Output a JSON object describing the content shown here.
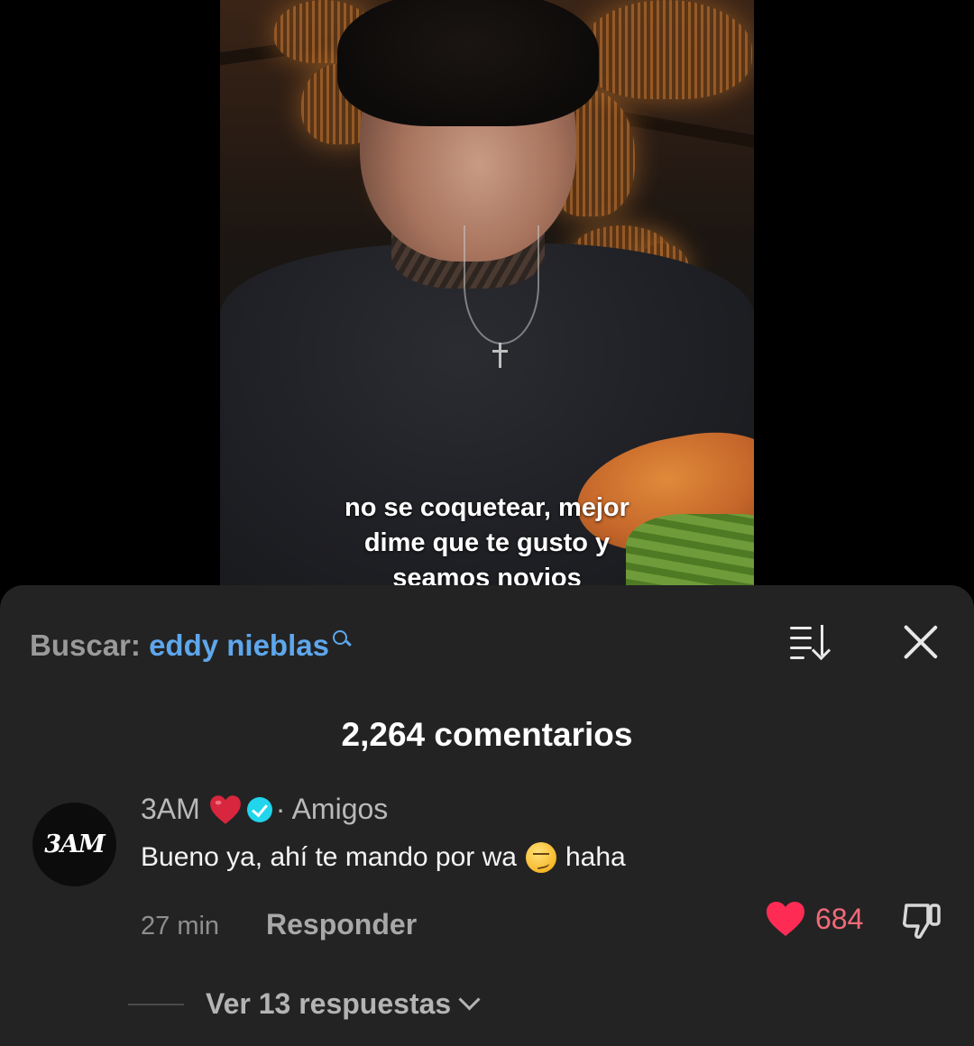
{
  "video": {
    "caption_lines": [
      "no se coquetear, mejor",
      "dime que te gusto y",
      "seamos novios"
    ]
  },
  "comments_panel": {
    "search_label": "Buscar:",
    "search_query": "eddy nieblas",
    "count_label": "2,264 comentarios",
    "icons": {
      "search": "search-icon",
      "sort": "sort-icon",
      "close": "close-icon"
    }
  },
  "comment": {
    "avatar_text": "3AM",
    "username": "3AM",
    "username_emoji": "red-heart-emoji",
    "verified": true,
    "relation": "· Amigos",
    "text_before_emoji": "Bueno ya, ahí te mando por wa",
    "emoji": "smirking-face-emoji",
    "text_after_emoji": "haha",
    "time": "27 min",
    "reply_label": "Responder",
    "likes": "684",
    "liked": true,
    "like_color": "#fe2c55",
    "verified_color": "#20d5ec",
    "view_replies_label": "Ver 13 respuestas"
  }
}
